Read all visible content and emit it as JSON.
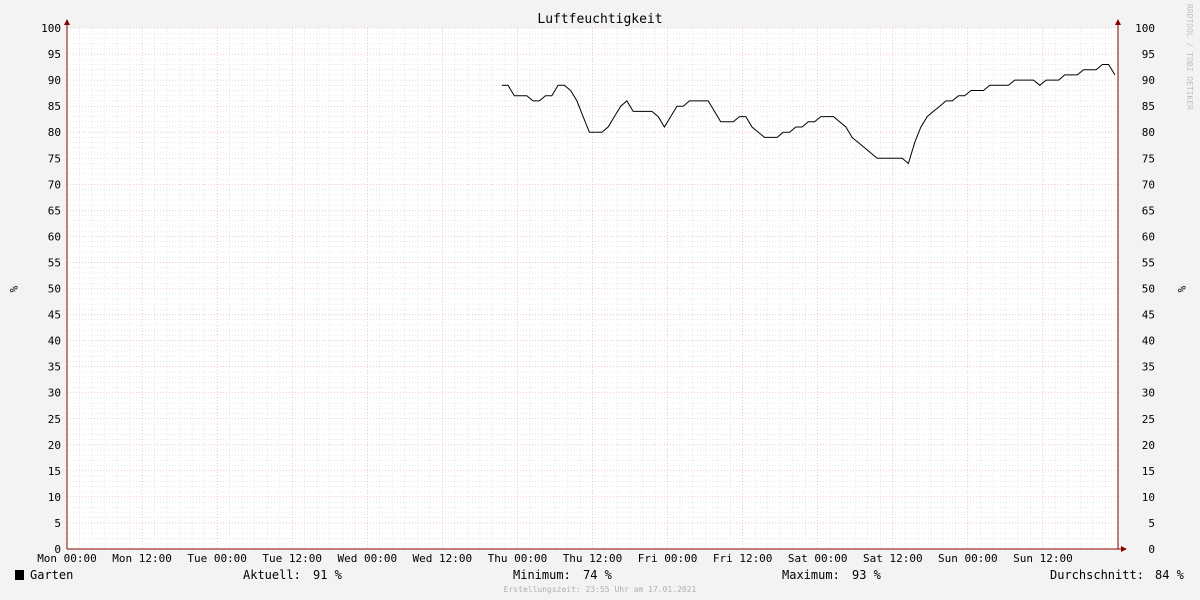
{
  "chart_data": {
    "type": "line",
    "title": "Luftfeuchtigkeit",
    "ylabel": "%",
    "ylim": [
      0,
      100
    ],
    "y_ticks": [
      "0",
      "5",
      "10",
      "15",
      "20",
      "25",
      "30",
      "35",
      "40",
      "45",
      "50",
      "55",
      "60",
      "65",
      "70",
      "75",
      "80",
      "85",
      "90",
      "95",
      "100"
    ],
    "x_ticks": [
      "Mon 00:00",
      "Mon 12:00",
      "Tue 00:00",
      "Tue 12:00",
      "Wed 00:00",
      "Wed 12:00",
      "Thu 00:00",
      "Thu 12:00",
      "Fri 00:00",
      "Fri 12:00",
      "Sat 00:00",
      "Sat 12:00",
      "Sun 00:00",
      "Sun 12:00"
    ],
    "xlim_hours": [
      0,
      168
    ],
    "grid": true,
    "colors": {
      "background": "#f3f3f3",
      "canvas": "#ffffff",
      "grid_minor": "#d0d0d0",
      "grid_major": "#e8a0a8",
      "axis": "#8b0000",
      "line": "#000000"
    },
    "series": [
      {
        "name": "Garten",
        "x_hours": [
          69.5,
          70.5,
          71.5,
          72.5,
          73.5,
          74.5,
          75.5,
          76.5,
          77.5,
          78.5,
          79.5,
          80.5,
          81.5,
          82.5,
          83.5,
          84.5,
          85.5,
          86.5,
          87.5,
          88.5,
          89.5,
          90.5,
          91.5,
          92.5,
          93.5,
          94.5,
          95.5,
          96.5,
          97.5,
          98.5,
          99.5,
          100.5,
          101.5,
          102.5,
          103.5,
          104.5,
          105.5,
          106.5,
          107.5,
          108.5,
          109.5,
          110.5,
          111.5,
          112.5,
          113.5,
          114.5,
          115.5,
          116.5,
          117.5,
          118.5,
          119.5,
          120.5,
          121.5,
          122.5,
          123.5,
          124.5,
          125.5,
          126.5,
          127.5,
          128.5,
          129.5,
          130.5,
          131.5,
          132.5,
          133.5,
          134.5,
          135.5,
          136.5,
          137.5,
          138.5,
          139.5,
          140.5,
          141.5,
          142.5,
          143.5,
          144.5,
          145.5,
          146.5,
          147.5,
          148.5,
          149.5,
          150.5,
          151.5,
          152.5,
          153.5,
          154.5,
          155.5,
          156.5,
          157.5,
          158.5,
          159.5,
          160.5,
          161.5,
          162.5,
          163.5,
          164.5,
          165.5,
          166.5,
          167.5
        ],
        "values": [
          89,
          89,
          87,
          87,
          87,
          86,
          86,
          87,
          87,
          89,
          89,
          88,
          86,
          83,
          80,
          80,
          80,
          81,
          83,
          85,
          86,
          84,
          84,
          84,
          84,
          83,
          81,
          83,
          85,
          85,
          86,
          86,
          86,
          86,
          84,
          82,
          82,
          82,
          83,
          83,
          81,
          80,
          79,
          79,
          79,
          80,
          80,
          81,
          81,
          82,
          82,
          83,
          83,
          83,
          82,
          81,
          79,
          78,
          77,
          76,
          75,
          75,
          75,
          75,
          75,
          74,
          78,
          81,
          83,
          84,
          85,
          86,
          86,
          87,
          87,
          88,
          88,
          88,
          89,
          89,
          89,
          89,
          90,
          90,
          90,
          90,
          89,
          90,
          90,
          90,
          91,
          91,
          91,
          92,
          92,
          92,
          93,
          93,
          91
        ]
      }
    ],
    "legend": {
      "series_name": "Garten",
      "current_label": "Aktuell:",
      "current_value": "91 %",
      "min_label": "Minimum:",
      "min_value": "74 %",
      "max_label": "Maximum:",
      "max_value": "93 %",
      "avg_label": "Durchschnitt:",
      "avg_value": "84 %"
    },
    "footer": "Erstellungszeit: 23:55 Uhr am 17.01.2021",
    "watermark": "RRDTOOL / TOBI OETIKER"
  }
}
